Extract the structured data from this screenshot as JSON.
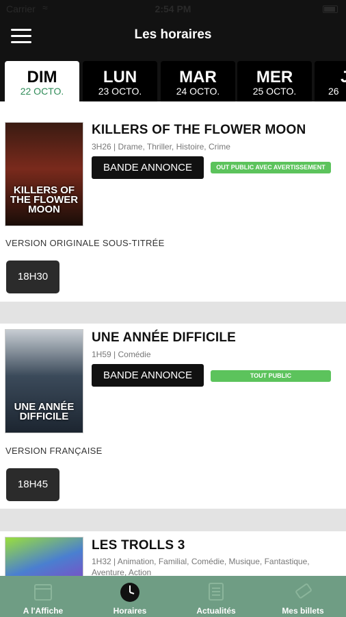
{
  "status": {
    "carrier": "Carrier",
    "time": "2:54 PM"
  },
  "header": {
    "title": "Les horaires"
  },
  "tabs": [
    {
      "day": "DIM",
      "date": "22 OCTO."
    },
    {
      "day": "LUN",
      "date": "23 OCTO."
    },
    {
      "day": "MAR",
      "date": "24 OCTO."
    },
    {
      "day": "MER",
      "date": "25 OCTO."
    },
    {
      "day": "J",
      "date": "26"
    }
  ],
  "movies": [
    {
      "title": "KILLERS OF THE FLOWER MOON",
      "meta": "3H26 | Drame, Thriller, Histoire, Crime",
      "trailer": "BANDE ANNONCE",
      "rating": "OUT PUBLIC AVEC AVERTISSEMENT",
      "version": "VERSION ORIGINALE SOUS-TITRÉE",
      "showtime": "18H30",
      "poster_text": "KILLERS OF THE FLOWER MOON",
      "poster_color": "#7a2a1c"
    },
    {
      "title": "UNE ANNÉE DIFFICILE",
      "meta": "1H59 | Comédie",
      "trailer": "BANDE ANNONCE",
      "rating": "TOUT PUBLIC",
      "version": "VERSION FRANÇAISE",
      "showtime": "18H45",
      "poster_text": "UNE ANNÉE DIFFICILE",
      "poster_color": "#3b4a5a"
    },
    {
      "title": "LES TROLLS 3",
      "meta": "1H32 | Animation, Familial, Comédie, Musique, Fantastique, Aventure, Action",
      "poster_color": "#4a7fd0"
    }
  ],
  "nav": [
    {
      "label": "A l'Affiche",
      "icon": "calendar-icon"
    },
    {
      "label": "Horaires",
      "icon": "clock-icon"
    },
    {
      "label": "Actualités",
      "icon": "news-icon"
    },
    {
      "label": "Mes billets",
      "icon": "ticket-icon"
    }
  ],
  "colors": {
    "header": "#121212",
    "rating": "#5cc35c",
    "nav": "#6f9d84",
    "active_date": "#2e8b57"
  }
}
